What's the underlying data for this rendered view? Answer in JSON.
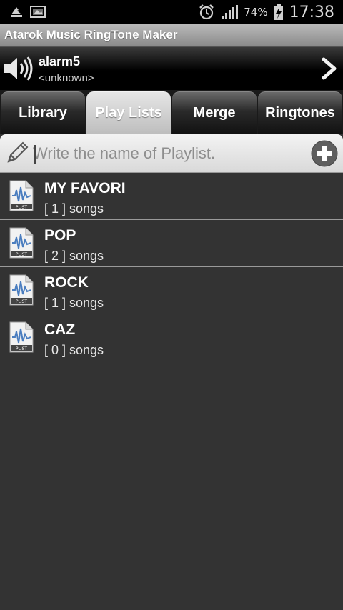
{
  "status_bar": {
    "battery_percent": "74%",
    "time": "17:38"
  },
  "app": {
    "title": "Atarok Music RingTone Maker"
  },
  "now_playing": {
    "track": "alarm5",
    "artist": "<unknown>"
  },
  "tabs": [
    {
      "label": "Library",
      "active": false
    },
    {
      "label": "Play Lists",
      "active": true
    },
    {
      "label": "Merge",
      "active": false
    },
    {
      "label": "Ringtones",
      "active": false
    }
  ],
  "playlist_input": {
    "placeholder": "Write the name of Playlist.",
    "value": ""
  },
  "playlists": [
    {
      "name": "MY FAVORI",
      "count": "[ 1 ] songs"
    },
    {
      "name": "POP",
      "count": "[ 2 ] songs"
    },
    {
      "name": "ROCK",
      "count": "[ 1 ] songs"
    },
    {
      "name": "CAZ",
      "count": "[ 0 ] songs"
    }
  ],
  "icons": {
    "playlist_file": "playlist-file-icon",
    "speaker": "speaker-icon",
    "next": "chevron-right-icon",
    "pencil": "pencil-icon",
    "add": "plus-circle-icon"
  },
  "file_icon_label": "PLIST",
  "colors": {
    "background": "#333333",
    "title_bar": "#9e9e9e",
    "active_tab": "#cfcfcf"
  }
}
